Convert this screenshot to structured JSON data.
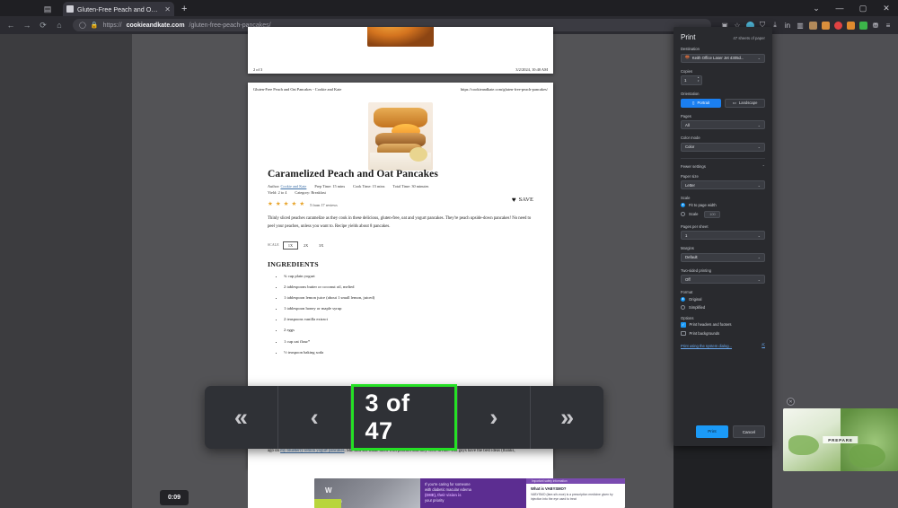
{
  "window": {
    "controls": [
      "⌄",
      "—",
      "▢",
      "✕"
    ]
  },
  "browser": {
    "tab": {
      "title": "Gluten-Free Peach and Oat Pan",
      "close": "✕"
    },
    "new_tab": "+",
    "tab_tool_icon": "collections-icon",
    "nav": {
      "back": "←",
      "forward": "→",
      "reload": "⟳",
      "home": "⌂"
    },
    "omnibox": {
      "shield_icon": "◯",
      "lock_icon": "🔒",
      "url_prefix": "https://",
      "url_domain": "cookieandkate.com",
      "url_path": "/gluten-free-peach-pancakes/",
      "split_icon": "▣",
      "favorite_icon": "☆"
    },
    "extensions": [
      {
        "name": "profile-avatar-icon",
        "color": "#4fb6d8"
      },
      {
        "name": "shield-icon",
        "color": "#9aa0a6"
      },
      {
        "name": "download-icon",
        "color": "#c2c2ca"
      },
      {
        "name": "linkedin-icon",
        "color": "#c2c2ca"
      },
      {
        "name": "sidebar-icon",
        "color": "#c2c2ca"
      },
      {
        "name": "lock-extension-icon",
        "color": "#b28a5a"
      },
      {
        "name": "orange-extension-icon",
        "color": "#d98f3c"
      },
      {
        "name": "red-extension-icon",
        "color": "#e04242"
      },
      {
        "name": "amber-extension-icon",
        "color": "#e08a2e"
      },
      {
        "name": "green-extension-icon",
        "color": "#3cb44a"
      },
      {
        "name": "collections-icon",
        "color": "#c2c2ca"
      },
      {
        "name": "settings-menu-icon",
        "color": "#c2c2ca"
      }
    ]
  },
  "document": {
    "previous_page": {
      "footer_left": "2 of 3",
      "footer_right": "3/2/2024, 10:40 AM"
    },
    "current_page": {
      "header_left": "Gluten-Free Peach and Oat Pancakes - Cookie and Kate",
      "header_right": "https://cookieandkate.com/gluten-free-peach-pancakes/",
      "title": "Caramelized Peach and Oat Pancakes",
      "meta": [
        "Author: Cookie and Kate",
        "Prep Time: 15 mins",
        "Cook Time: 15 mins",
        "Total Time: 30 minutes",
        "Yield: 2 to 4",
        "Category: Breakfast"
      ],
      "author_label": "Author:",
      "author_link": "Cookie and Kate",
      "rating_stars": "★★★★★",
      "rating_text": "5 from 17 reviews",
      "save_label": "SAVE",
      "save_icon": "♥",
      "description": "Thinly sliced peaches caramelize as they cook in these delicious, gluten-free, oat and yogurt pancakes. They're peach upside-down pancakes! No need to peel your peaches, unless you want to. Recipe yields about 8 pancakes.",
      "scale_label": "SCALE",
      "scale_options": [
        "1X",
        "2X",
        "3X"
      ],
      "scale_selected": "1X",
      "ingredients_heading": "INGREDIENTS",
      "ingredients": [
        "¾ cup plain yogurt",
        "2 tablespoons butter or coconut oil, melted",
        "1 tablespoon lemon juice (about 1 small lemon, juiced)",
        "1 tablespoon honey or maple syrup",
        "2 teaspoons vanilla extract",
        "2 eggs",
        "1 cup oat flour*",
        "½ teaspoon baking soda"
      ],
      "tail_text_prefix": "ago on",
      "tail_link": "my blueberry lemon yogurt pancakes",
      "tail_text_suffix": ". She said she made them with peaches and they were divine. You guys have the best ideas (thanks,"
    }
  },
  "page_nav": {
    "first_label": "«",
    "prev_label": "‹",
    "counter": "3 of 47",
    "next_label": "›",
    "last_label": "»",
    "highlight_color": "#25e025"
  },
  "print_panel": {
    "title": "Print",
    "sheets": "47 sheets of paper",
    "destination": {
      "label": "Destination",
      "value": "Keith Office Laser Jet 4305d...",
      "icon": "printer-icon"
    },
    "copies": {
      "label": "Copies",
      "value": "1"
    },
    "orientation": {
      "label": "Orientation",
      "portrait": "Portrait",
      "landscape": "Landscape",
      "selected": "Portrait"
    },
    "pages": {
      "label": "Pages",
      "value": "All"
    },
    "color_mode": {
      "label": "Color mode",
      "value": "Color"
    },
    "fewer_settings": {
      "label": "Fewer settings",
      "caret": "⌃"
    },
    "paper_size": {
      "label": "Paper size",
      "value": "Letter"
    },
    "scale": {
      "label": "Scale",
      "fit_label": "Fit to page width",
      "custom_label": "Scale",
      "custom_value": "100",
      "selected": "Fit to page width"
    },
    "pages_per_sheet": {
      "label": "Pages per sheet",
      "value": "1"
    },
    "margins": {
      "label": "Margins",
      "value": "Default"
    },
    "two_sided": {
      "label": "Two-sided printing",
      "value": "Off"
    },
    "format": {
      "label": "Format",
      "original": "Original",
      "simplified": "Simplified",
      "selected": "Original"
    },
    "options": {
      "label": "Options",
      "headers_footers": "Print headers and footers",
      "headers_footers_checked": true,
      "backgrounds": "Print backgrounds",
      "backgrounds_checked": false
    },
    "system_dialog": {
      "label": "Print using the system dialog...",
      "icon": "external-link-icon"
    },
    "actions": {
      "print": "Print",
      "cancel": "Cancel"
    },
    "accent_color": "#1b9af7"
  },
  "overlays": {
    "timer": "0:09",
    "video_card": {
      "label": "PREPARE",
      "close_icon": "✕"
    },
    "ad": {
      "brand": "VABYSMO",
      "logo_mark": "W",
      "headline_1": "If you're caring for someone",
      "headline_2": "with diabetic macular edema",
      "headline_3": "(DME), their vision is",
      "headline_4": "your priority",
      "highlight_word": "(DME)",
      "ribbon": "Important safety information",
      "info_title": "What is VABYSMO?",
      "info_body": "VABYSMO (fare-sih-moe) is a prescription medicine given by injection into the eye used to treat"
    }
  }
}
